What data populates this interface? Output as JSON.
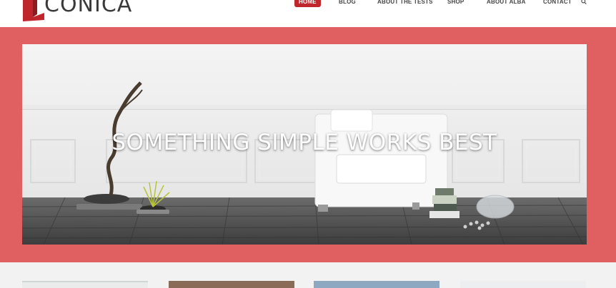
{
  "brand": {
    "logo_text": "CONICA",
    "accent": "#c0272d"
  },
  "nav": {
    "items": [
      "HOME",
      "BLOG",
      "ABOUT THE TESTS",
      "SHOP",
      "ABOUT ALBA",
      "CONTACT"
    ],
    "active": "HOME",
    "search_icon": "search-icon"
  },
  "hero": {
    "title": "SOMETHING SIMPLE WORKS BEST",
    "band_color": "#e06062"
  },
  "thumbnails": [
    "window-scene",
    "wood-scene",
    "frames-scene",
    "room-scene"
  ]
}
